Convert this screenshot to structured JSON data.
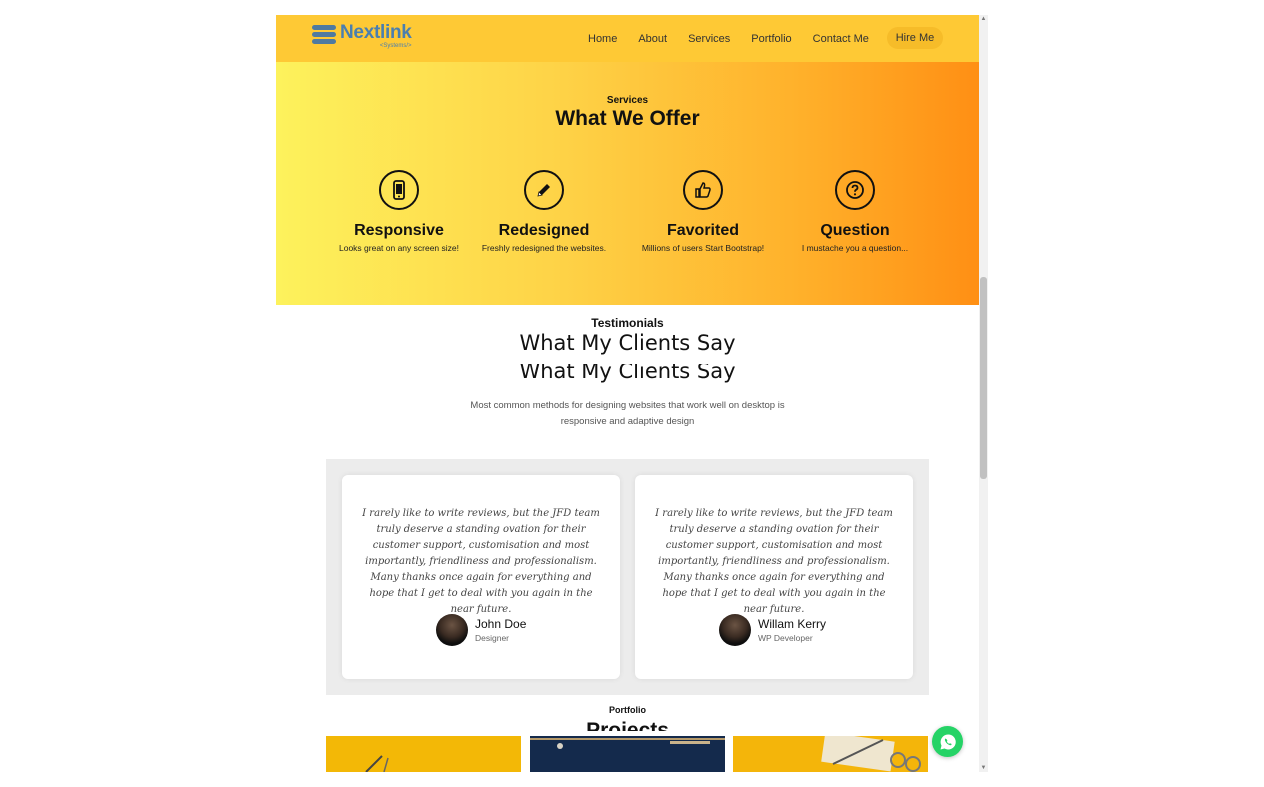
{
  "brand": {
    "name": "Nextlink",
    "tagline": "<Systems/>"
  },
  "nav": {
    "items": [
      "Home",
      "About",
      "Services",
      "Portfolio",
      "Contact Me"
    ],
    "cta": "Hire Me"
  },
  "services": {
    "eyebrow": "Services",
    "title": "What We Offer",
    "items": [
      {
        "icon": "mobile-phone-icon",
        "title": "Responsive",
        "desc": "Looks great on any screen size!"
      },
      {
        "icon": "pencil-icon",
        "title": "Redesigned",
        "desc": "Freshly redesigned the websites."
      },
      {
        "icon": "thumbs-up-icon",
        "title": "Favorited",
        "desc": "Millions of users Start Bootstrap!"
      },
      {
        "icon": "question-icon",
        "title": "Question",
        "desc": "I mustache you a question..."
      }
    ]
  },
  "testimonials": {
    "eyebrow": "Testimonials",
    "title": "What My Clients Say",
    "desc": "Most common methods for designing websites that work well on desktop is responsive and adaptive design",
    "cards": [
      {
        "quote": "I rarely like to write reviews, but the JFD team truly deserve a standing ovation for their customer support, customisation and most importantly, friendliness and professionalism. Many thanks once again for everything and hope that I get to deal with you again in the near future.",
        "name": "John Doe",
        "role": "Designer"
      },
      {
        "quote": "I rarely like to write reviews, but the JFD team truly deserve a standing ovation for their customer support, customisation and most importantly, friendliness and professionalism. Many thanks once again for everything and hope that I get to deal with you again in the near future.",
        "name": "Willam Kerry",
        "role": "WP Developer"
      }
    ]
  },
  "portfolio": {
    "eyebrow": "Portfolio",
    "title": "Projects"
  },
  "colors": {
    "navbar": "#fec935",
    "gradient_start": "#fdf25c",
    "gradient_end": "#ff8f14",
    "logo": "#4a7fb0",
    "whatsapp": "#25d366"
  }
}
